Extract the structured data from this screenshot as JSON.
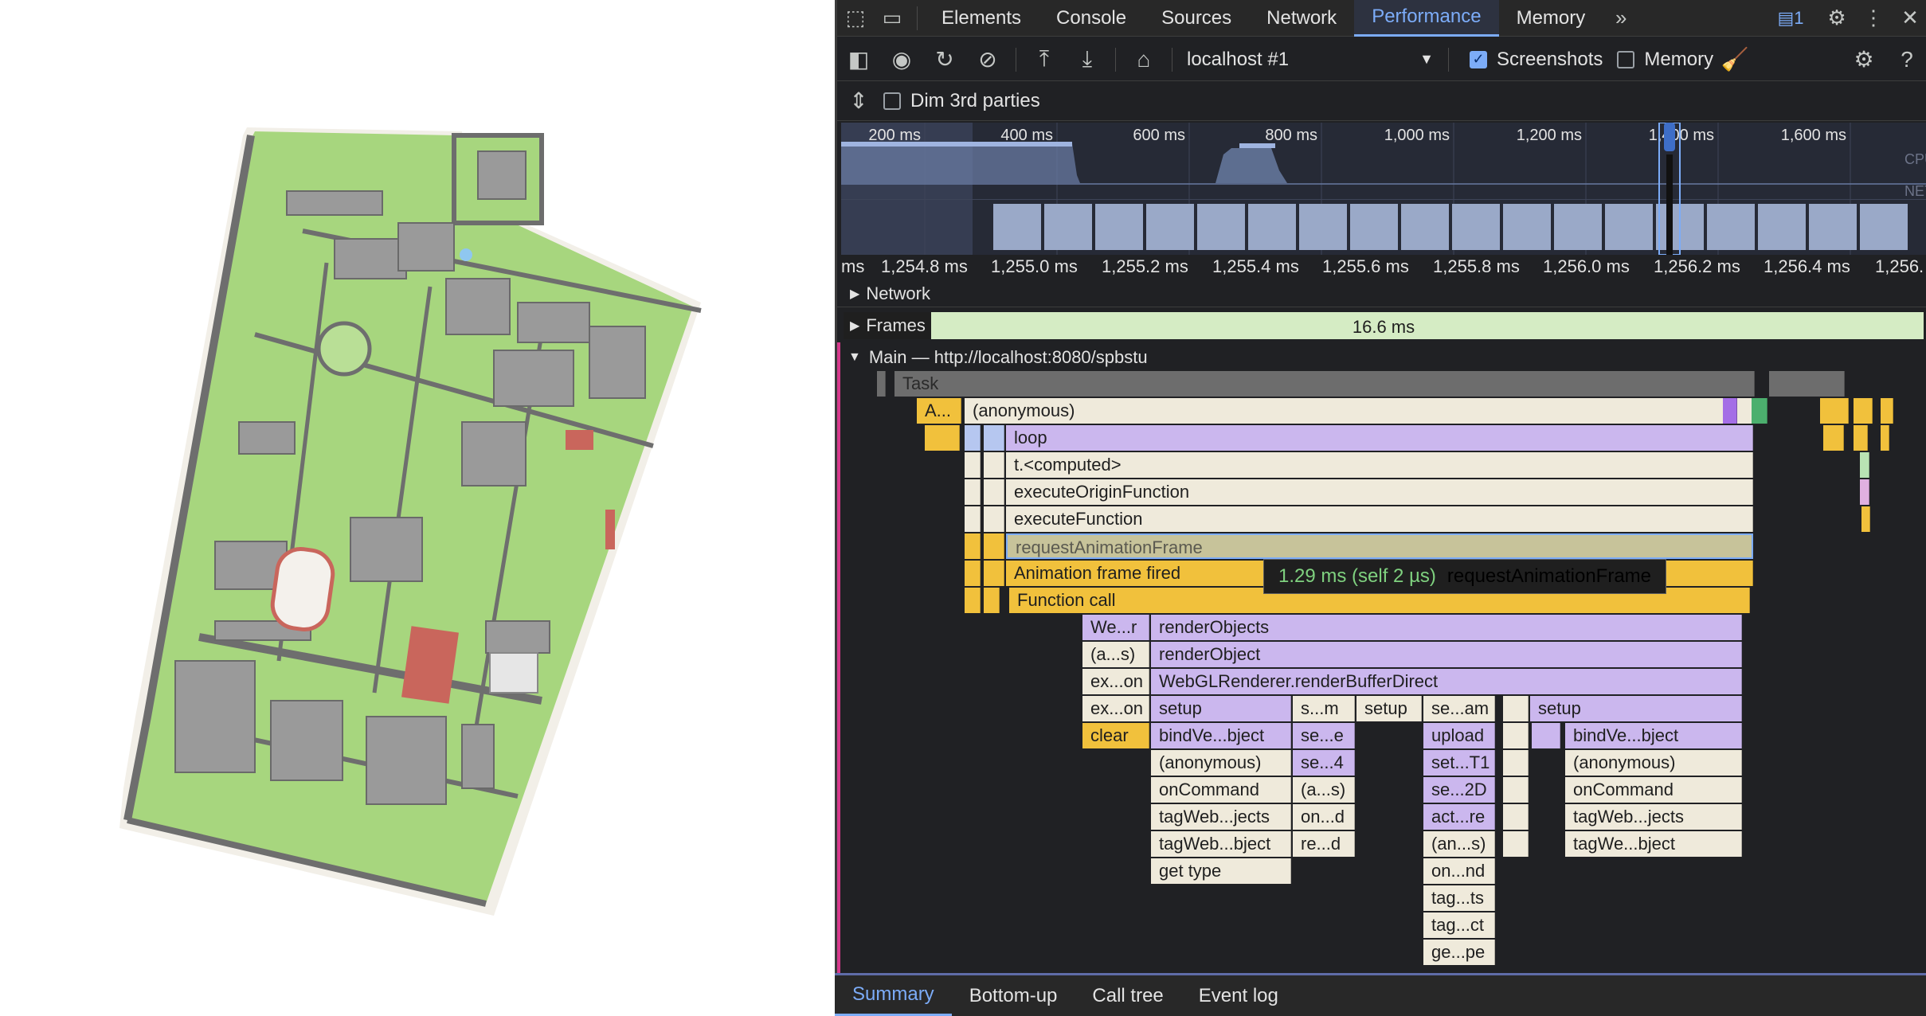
{
  "devtools": {
    "tabs": [
      {
        "label": "Elements"
      },
      {
        "label": "Console"
      },
      {
        "label": "Sources"
      },
      {
        "label": "Network"
      },
      {
        "label": "Performance"
      },
      {
        "label": "Memory"
      }
    ],
    "more_tabs_glyph": "»",
    "issues_count": "1",
    "toolbar": {
      "target": "localhost #1",
      "screenshots_label": "Screenshots",
      "screenshots_checked": true,
      "memory_label": "Memory",
      "memory_checked": false,
      "dim_label": "Dim 3rd parties",
      "dim_checked": false
    },
    "overview": {
      "ticks": [
        "200 ms",
        "400 ms",
        "600 ms",
        "800 ms",
        "1,000 ms",
        "1,200 ms",
        "1,400 ms",
        "1,600 ms"
      ],
      "cpu_label": "CPU",
      "net_label": "NET"
    },
    "ruler": [
      "ms",
      "1,254.8 ms",
      "1,255.0 ms",
      "1,255.2 ms",
      "1,255.4 ms",
      "1,255.6 ms",
      "1,255.8 ms",
      "1,256.0 ms",
      "1,256.2 ms",
      "1,256.4 ms",
      "1,256."
    ],
    "network_label": "Network",
    "frames_label": "Frames",
    "frames_time": "16.6 ms",
    "main_label": "Main — http://localhost:8080/spbstu",
    "flame": [
      {
        "label": "Task",
        "color": "task"
      },
      {
        "label": "A...",
        "color": "yellow"
      },
      {
        "label": "(anonymous)",
        "color": "cream"
      },
      {
        "label": "loop",
        "color": "purple"
      },
      {
        "label": "t.<computed>",
        "color": "cream"
      },
      {
        "label": "executeOriginFunction",
        "color": "cream"
      },
      {
        "label": "executeFunction",
        "color": "cream"
      },
      {
        "label": "requestAnimationFrame",
        "color": "sel"
      },
      {
        "label": "Animation frame fired",
        "color": "yellow"
      },
      {
        "label": "Function call",
        "color": "yellow"
      },
      {
        "label": "We...r",
        "color": "purple"
      },
      {
        "label": "renderObjects",
        "color": "purple"
      },
      {
        "label": "(a...s)",
        "color": "cream"
      },
      {
        "label": "renderObject",
        "color": "purple"
      },
      {
        "label": "ex...on",
        "color": "cream"
      },
      {
        "label": "WebGLRenderer.renderBufferDirect",
        "color": "purple"
      },
      {
        "label": "ex...on",
        "color": "cream"
      },
      {
        "label": "setup",
        "color": "purple"
      },
      {
        "label": "s...m",
        "color": "cream"
      },
      {
        "label": "setup",
        "color": "cream"
      },
      {
        "label": "se...am",
        "color": "cream"
      },
      {
        "label": "setup",
        "color": "purple"
      },
      {
        "label": "clear",
        "color": "yellow"
      },
      {
        "label": "bindVe...bject",
        "color": "purple"
      },
      {
        "label": "se...e",
        "color": "purple"
      },
      {
        "label": "upload",
        "color": "purple"
      },
      {
        "label": "bindVe...bject",
        "color": "purple"
      },
      {
        "label": "(anonymous)",
        "color": "cream"
      },
      {
        "label": "se...4",
        "color": "purple"
      },
      {
        "label": "set...T1",
        "color": "purple"
      },
      {
        "label": "(anonymous)",
        "color": "cream"
      },
      {
        "label": "onCommand",
        "color": "cream"
      },
      {
        "label": "(a...s)",
        "color": "cream"
      },
      {
        "label": "se...2D",
        "color": "purple"
      },
      {
        "label": "onCommand",
        "color": "cream"
      },
      {
        "label": "tagWeb...jects",
        "color": "cream"
      },
      {
        "label": "on...d",
        "color": "cream"
      },
      {
        "label": "act...re",
        "color": "purple"
      },
      {
        "label": "tagWeb...jects",
        "color": "cream"
      },
      {
        "label": "tagWeb...bject",
        "color": "cream"
      },
      {
        "label": "re...d",
        "color": "cream"
      },
      {
        "label": "(an...s)",
        "color": "cream"
      },
      {
        "label": "tagWe...bject",
        "color": "cream"
      },
      {
        "label": "get type",
        "color": "cream"
      },
      {
        "label": "on...nd",
        "color": "cream"
      },
      {
        "label": "tag...ts",
        "color": "cream"
      },
      {
        "label": "tag...ct",
        "color": "cream"
      },
      {
        "label": "ge...pe",
        "color": "cream"
      }
    ],
    "tooltip": {
      "time": "1.29 ms (self 2 µs)",
      "name": "requestAnimationFrame"
    },
    "bottom_tabs": [
      {
        "label": "Summary"
      },
      {
        "label": "Bottom-up"
      },
      {
        "label": "Call tree"
      },
      {
        "label": "Event log"
      }
    ]
  }
}
